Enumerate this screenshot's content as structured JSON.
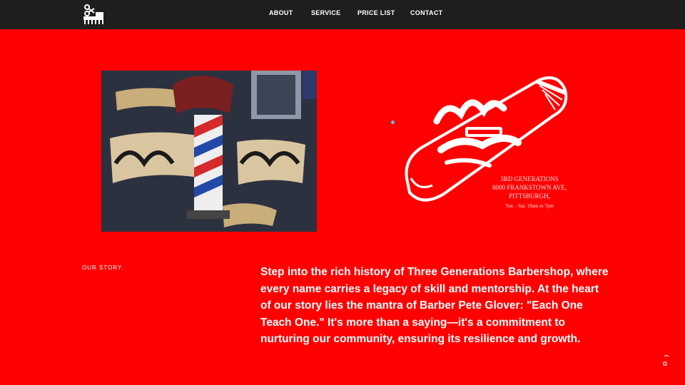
{
  "header": {
    "logo_icon": "clipper-comb-logo",
    "nav": [
      "ABOUT",
      "SERVICE",
      "PRICE LIST",
      "CONTACT"
    ]
  },
  "hero": {
    "photo_icon": "barber-shop-mural-photo",
    "brand_art_icon": "make-today-epic-clipper-logo",
    "address_lines": [
      "3RD GENERATIONS",
      "8000 FRANKSTOWN AVE,",
      "PITTSBURGH,"
    ],
    "hours": "Tue. - Sat. 10am to 7pm"
  },
  "story": {
    "label": "OUR STORY.",
    "text": "Step into the rich history of Three Generations Barbershop, where every name carries a legacy of skill and mentorship. At the heart of our story lies the mantra of Barber Pete Glover: \"Each One Teach One.\" It's more than a saying—it's a commitment to nurturing our community, ensuring its resilience and growth."
  },
  "colors": {
    "background": "#ff0000",
    "topbar": "#1e1e1e",
    "text": "#ffffff",
    "accent_dot": "#4fc3f7"
  }
}
